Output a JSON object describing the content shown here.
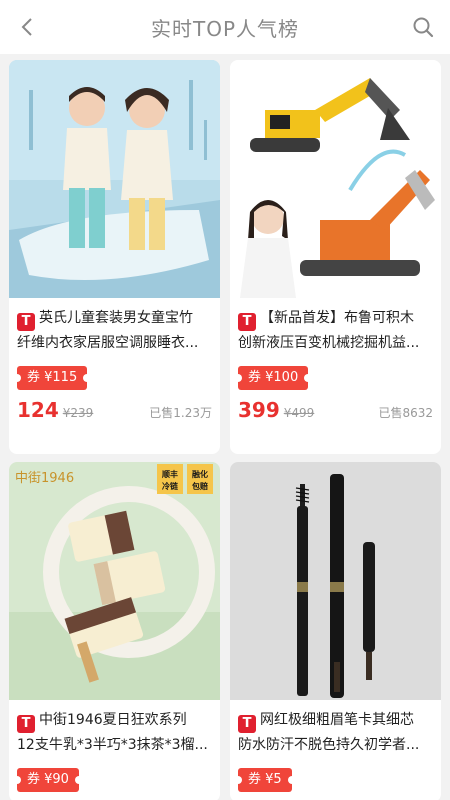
{
  "header": {
    "title": "实时TOP人气榜"
  },
  "icons": {
    "back": "chevron-left-icon",
    "search": "search-icon"
  },
  "colors": {
    "accent": "#e8312f",
    "coupon": "#f0453a",
    "tmall": "#e0202f"
  },
  "products": [
    {
      "badge": "T",
      "line1": "英氏儿童套装男女童宝竹",
      "line2": "纤维内衣家居服空调服睡衣...",
      "coupon": "券 ¥115",
      "price": "124",
      "original_price": "¥239",
      "sold": "已售1.23万"
    },
    {
      "badge": "T",
      "line1": "【新品首发】布鲁可积木",
      "line2": "创新液压百变机械挖掘机益...",
      "coupon": "券 ¥100",
      "price": "399",
      "original_price": "¥499",
      "sold": "已售8632"
    },
    {
      "badge": "T",
      "line1": "中街1946夏日狂欢系列",
      "line2": "12支牛乳*3半巧*3抹茶*3榴...",
      "coupon": "券 ¥90",
      "image_text": {
        "logo": "中街1946",
        "tag1_a": "顺丰",
        "tag1_b": "冷链",
        "tag2_a": "融化",
        "tag2_b": "包赔"
      }
    },
    {
      "badge": "T",
      "line1": "网红极细粗眉笔卡其细芯",
      "line2": "防水防汗不脱色持久初学者...",
      "coupon": "券 ¥5"
    }
  ]
}
